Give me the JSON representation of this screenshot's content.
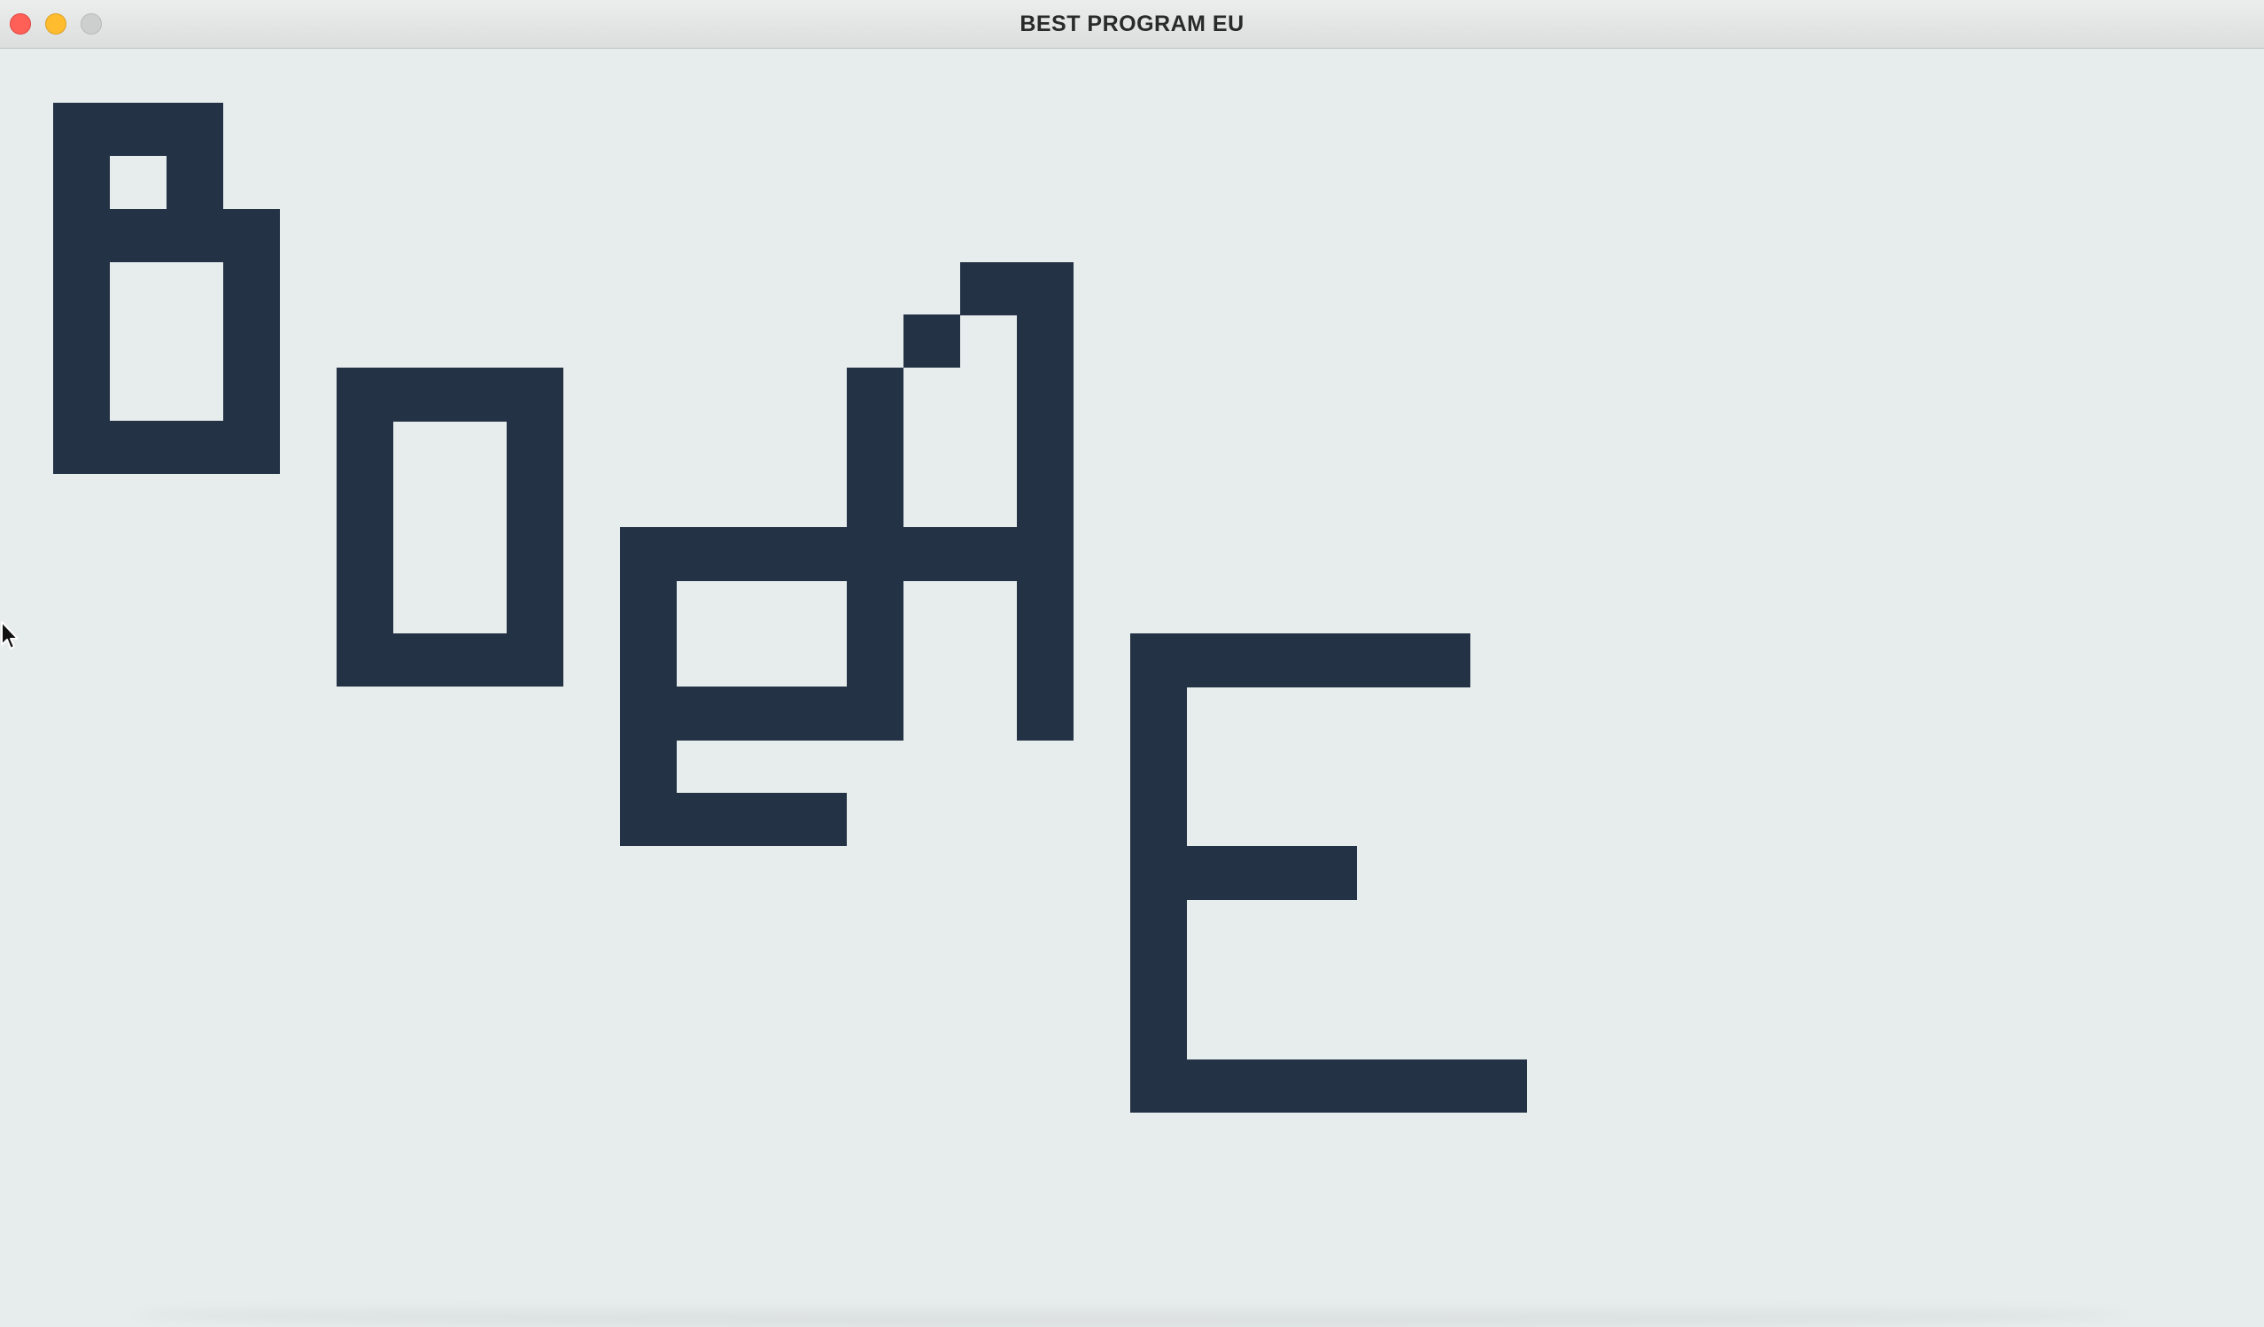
{
  "window": {
    "title": "BEST PROGRAM EU",
    "controls": [
      "close",
      "minimize",
      "zoom"
    ]
  },
  "canvas": {
    "background_color": "#e7ecec",
    "glyph_color": "#233345",
    "glyphs": [
      "B",
      "o",
      "e",
      "A",
      "E"
    ],
    "pointer": "arrow-cursor-icon"
  }
}
